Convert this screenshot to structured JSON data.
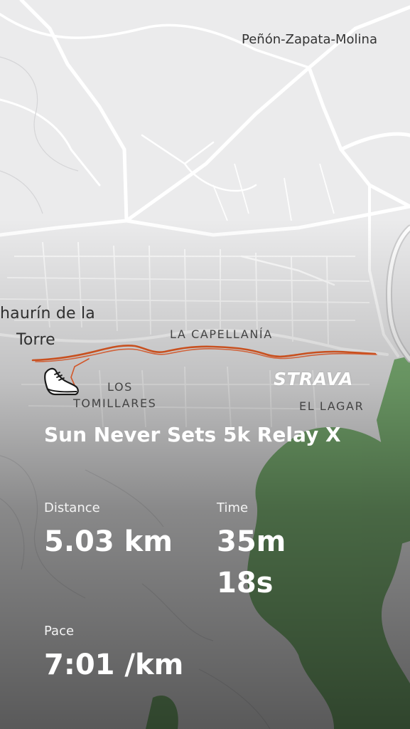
{
  "map": {
    "places": {
      "city_top_right": "Peñón-Zapata-Molina",
      "town_line1": "haurín de la",
      "town_line2": "Torre",
      "neighborhood_capellania": "LA CAPELLANÍA",
      "neighborhood_tomillares_1": "LOS",
      "neighborhood_tomillares_2": "TOMILLARES",
      "neighborhood_lagar": "EL LAGAR"
    },
    "route_color": "#d2572a",
    "park_color": "#4f9a45"
  },
  "brand": {
    "logo": "STRAVA"
  },
  "activity": {
    "title": "Sun Never Sets 5k Relay X",
    "stats": {
      "distance_label": "Distance",
      "distance_value": "5.03 km",
      "time_label": "Time",
      "time_value": "35m 18s",
      "pace_label": "Pace",
      "pace_value": "7:01 /km"
    }
  },
  "icons": {
    "activity_type": "running-shoe-icon"
  }
}
